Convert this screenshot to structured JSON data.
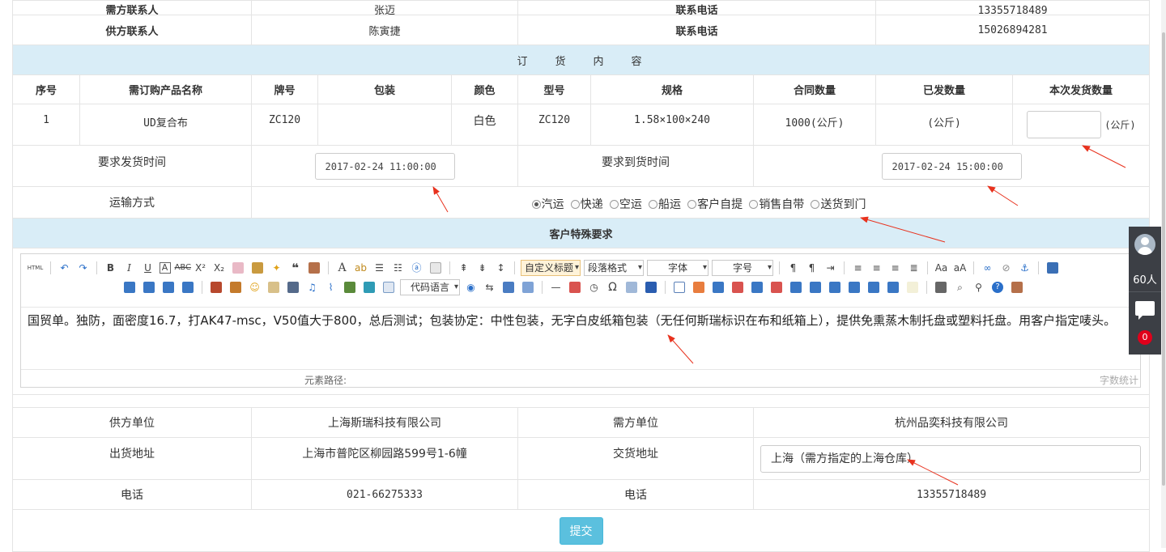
{
  "top_row": {
    "label1": "需方联系人",
    "value1": "张迈",
    "label2": "联系电话",
    "value2": "13355718489"
  },
  "contact_row": {
    "label1": "供方联系人",
    "value1": "陈寅捷",
    "label2": "联系电话",
    "value2": "15026894281"
  },
  "order_section_title": "订货内容",
  "columns": [
    "序号",
    "需订购产品名称",
    "牌号",
    "包装",
    "颜色",
    "型号",
    "规格",
    "合同数量",
    "已发数量",
    "本次发货数量"
  ],
  "item": {
    "index": "1",
    "name": "UD复合布",
    "grade": "ZC120",
    "packaging": "",
    "color": "白色",
    "model": "ZC120",
    "spec": "1.58×100×240",
    "contract_qty": "1000(公斤)",
    "shipped_qty": "(公斤)",
    "this_qty_value": "",
    "this_qty_unit": "(公斤)"
  },
  "times": {
    "ship_label": "要求发货时间",
    "ship_value": "2017-02-24 11:00:00",
    "arrive_label": "要求到货时间",
    "arrive_value": "2017-02-24 15:00:00"
  },
  "transport": {
    "label": "运输方式",
    "options": [
      {
        "label": "汽运",
        "selected": true
      },
      {
        "label": "快递",
        "selected": false
      },
      {
        "label": "空运",
        "selected": false
      },
      {
        "label": "船运",
        "selected": false
      },
      {
        "label": "客户自提",
        "selected": false
      },
      {
        "label": "销售自带",
        "selected": false
      },
      {
        "label": "送货到门",
        "selected": false
      }
    ]
  },
  "special_title": "客户特殊要求",
  "editor": {
    "combos": {
      "custom_title": "自定义标题",
      "paragraph": "段落格式",
      "font": "字体",
      "size": "字号",
      "code_lang": "代码语言"
    },
    "content": "国贸单。独防，面密度16.7，打AK47-msc，V50值大于800，总后测试；包装协定：中性包装，无字白皮纸箱包装（无任何斯瑞标识在布和纸箱上），提供免熏蒸木制托盘或塑料托盘。用客户指定唛头。",
    "path_label": "元素路径:",
    "word_count_label": "字数统计"
  },
  "parties": {
    "supplier_label": "供方单位",
    "supplier": "上海斯瑞科技有限公司",
    "buyer_label": "需方单位",
    "buyer": "杭州品奕科技有限公司",
    "ship_addr_label": "出货地址",
    "ship_addr": "上海市普陀区柳园路599号1-6幢",
    "deliver_addr_label": "交货地址",
    "deliver_addr": "上海（需方指定的上海仓库）",
    "phone_label1": "电话",
    "phone1": "021-66275333",
    "phone_label2": "电话",
    "phone2": "13355718489"
  },
  "submit_label": "提交",
  "side_widget": {
    "online_count": "60人",
    "badge": "0"
  },
  "colors": {
    "band": "#d9edf7",
    "submit": "#5bc0de",
    "arrow": "#e8321e",
    "side": "#3c3f45",
    "badge": "#e0001b"
  }
}
